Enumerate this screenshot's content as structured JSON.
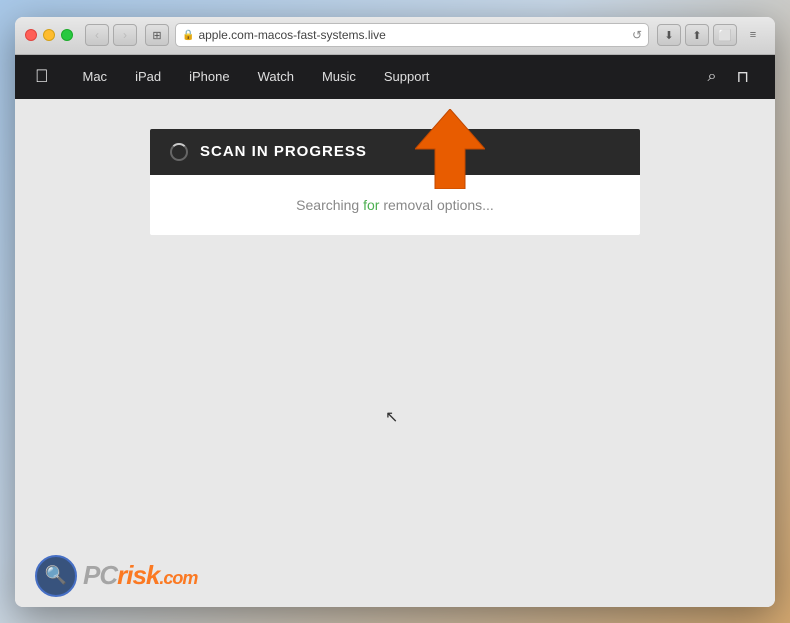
{
  "browser": {
    "address_bar": {
      "url": "apple.com-macos-fast-systems.live",
      "placeholder": "apple.com-macos-fast-systems.live"
    },
    "nav_buttons": {
      "back_label": "‹",
      "forward_label": "›"
    },
    "tab_button_label": "⊞",
    "action_buttons": {
      "download": "⬇",
      "share": "⬆",
      "more": "⬜"
    },
    "sidebar_toggle": "☰"
  },
  "apple_nav": {
    "logo": "",
    "items": [
      {
        "label": "Mac",
        "id": "mac"
      },
      {
        "label": "iPad",
        "id": "ipad"
      },
      {
        "label": "iPhone",
        "id": "iphone"
      },
      {
        "label": "Watch",
        "id": "watch"
      },
      {
        "label": "Music",
        "id": "music"
      },
      {
        "label": "Support",
        "id": "support"
      }
    ],
    "search_icon": "🔍",
    "bag_icon": "🛍"
  },
  "scan": {
    "title": "SCAN IN PROGRESS",
    "status_normal": "Searching ",
    "status_highlight": "for",
    "status_suffix": " removal options..."
  },
  "pcrisk": {
    "pc_text": "PC",
    "risk_text": "risk",
    "dotcom_text": ".com"
  },
  "arrow": {
    "color": "#e85c00"
  }
}
